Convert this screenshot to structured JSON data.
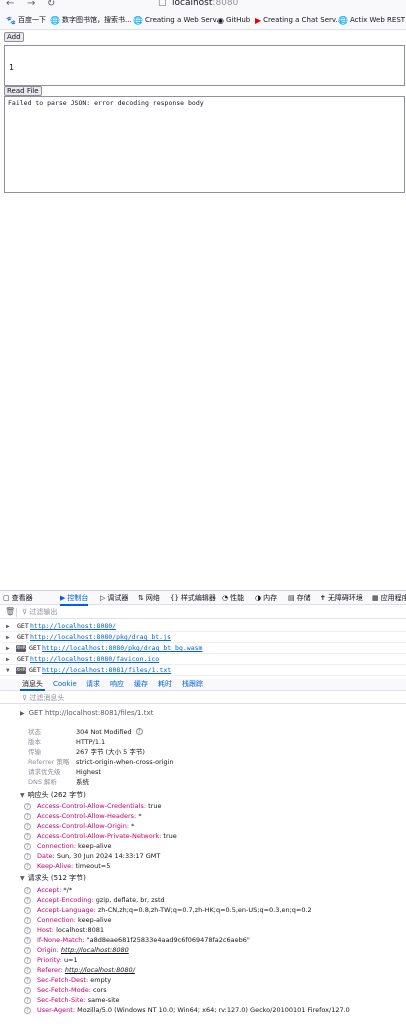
{
  "browser": {
    "nav": {
      "back": "←",
      "forward": "→",
      "reload": "↻"
    },
    "url_host": "localhost",
    "url_port": ":8080",
    "bookmarks": [
      {
        "icon": "baidu-paw-icon",
        "glyph": "🐾",
        "label": "百度一下"
      },
      {
        "icon": "globe-icon",
        "glyph": "🌐",
        "label": "数字图书馆，搜索书..."
      },
      {
        "icon": "globe-icon",
        "glyph": "🌐",
        "label": "Creating a Web Serv..."
      },
      {
        "icon": "github-icon",
        "glyph": "◉",
        "label": "GitHub"
      },
      {
        "icon": "youtube-icon",
        "glyph": "▶",
        "label": "Creating a Chat Serv..."
      },
      {
        "icon": "globe-icon",
        "glyph": "🌐",
        "label": "Actix Web REST API..."
      }
    ]
  },
  "page": {
    "add_label": "Add",
    "content_value": "1",
    "read_file_label": "Read File",
    "output_text": "Failed to parse JSON: error decoding response body"
  },
  "devtools": {
    "tabs": [
      {
        "glyph": "▢",
        "label": "查看器",
        "icon": "inspector-icon"
      },
      {
        "glyph": "▶",
        "label": "控制台",
        "icon": "console-icon"
      },
      {
        "glyph": "▷",
        "label": "调试器",
        "icon": "debugger-icon"
      },
      {
        "glyph": "⇅",
        "label": "网络",
        "icon": "network-icon"
      },
      {
        "glyph": "{}",
        "label": "样式编辑器",
        "icon": "style-editor-icon"
      },
      {
        "glyph": "◔",
        "label": "性能",
        "icon": "performance-icon"
      },
      {
        "glyph": "◑",
        "label": "内存",
        "icon": "memory-icon"
      },
      {
        "glyph": "▤",
        "label": "存储",
        "icon": "storage-icon"
      },
      {
        "glyph": "✝",
        "label": "无障碍环境",
        "icon": "accessibility-icon"
      },
      {
        "glyph": "▦",
        "label": "应用程序",
        "icon": "application-icon"
      }
    ],
    "filter_placeholder": "过滤输出",
    "requests": [
      {
        "xhr": false,
        "method": "GET",
        "url": "http://localhost:8080/"
      },
      {
        "xhr": false,
        "method": "GET",
        "url": "http://localhost:8080/pkg/drag_bt.js"
      },
      {
        "xhr": true,
        "method": "GET",
        "url": "http://localhost:8080/pkg/drag_bt_bg.wasm"
      },
      {
        "xhr": false,
        "method": "GET",
        "url": "http://localhost:8080/favicon.ico"
      },
      {
        "xhr": true,
        "method": "GET",
        "url": "http://localhost:8081/files/1.txt"
      }
    ],
    "xhr_badge": "XHR",
    "net_tabs": [
      "消息头",
      "Cookie",
      "请求",
      "响应",
      "缓存",
      "耗时",
      "栈跟踪"
    ],
    "header_filter_placeholder": "过滤消息头",
    "summary_line": "GET  http://localhost:8081/files/1.txt",
    "summary": [
      {
        "k": "状态",
        "v": "304 Not Modified"
      },
      {
        "k": "版本",
        "v": "HTTP/1.1"
      },
      {
        "k": "传输",
        "v": "267 字节 (大小 5 字节)"
      },
      {
        "k": "Referrer 策略",
        "v": "strict-origin-when-cross-origin"
      },
      {
        "k": "请求优先级",
        "v": "Highest"
      },
      {
        "k": "DNS 解析",
        "v": "系统"
      }
    ],
    "response_title": "响应头 (262 字节)",
    "response_headers": [
      {
        "n": "Access-Control-Allow-Credentials:",
        "v": "true"
      },
      {
        "n": "Access-Control-Allow-Headers:",
        "v": "*"
      },
      {
        "n": "Access-Control-Allow-Origin:",
        "v": "*"
      },
      {
        "n": "Access-Control-Allow-Private-Network:",
        "v": "true"
      },
      {
        "n": "Connection:",
        "v": "keep-alive"
      },
      {
        "n": "Date:",
        "v": "Sun, 30 Jun 2024 14:33:17 GMT"
      },
      {
        "n": "Keep-Alive:",
        "v": "timeout=5"
      }
    ],
    "request_title": "请求头 (512 字节)",
    "request_headers": [
      {
        "n": "Accept:",
        "v": "*/*"
      },
      {
        "n": "Accept-Encoding:",
        "v": "gzip, deflate, br, zstd"
      },
      {
        "n": "Accept-Language:",
        "v": "zh-CN,zh;q=0.8,zh-TW;q=0.7,zh-HK;q=0.5,en-US;q=0.3,en;q=0.2"
      },
      {
        "n": "Connection:",
        "v": "keep-alive"
      },
      {
        "n": "Host:",
        "v": "localhost:8081"
      },
      {
        "n": "If-None-Match:",
        "v": "\"a8d8eae681f25833e4aad9c6f069478fa2c6aeb6\""
      },
      {
        "n": "Origin:",
        "v": "http://localhost:8080",
        "link": true
      },
      {
        "n": "Priority:",
        "v": "u=1"
      },
      {
        "n": "Referer:",
        "v": "http://localhost:8080/",
        "link": true
      },
      {
        "n": "Sec-Fetch-Dest:",
        "v": "empty"
      },
      {
        "n": "Sec-Fetch-Mode:",
        "v": "cors"
      },
      {
        "n": "Sec-Fetch-Site:",
        "v": "same-site"
      },
      {
        "n": "User-Agent:",
        "v": "Mozilla/5.0 (Windows NT 10.0; Win64; x64; rv:127.0) Gecko/20100101 Firefox/127.0"
      }
    ]
  }
}
